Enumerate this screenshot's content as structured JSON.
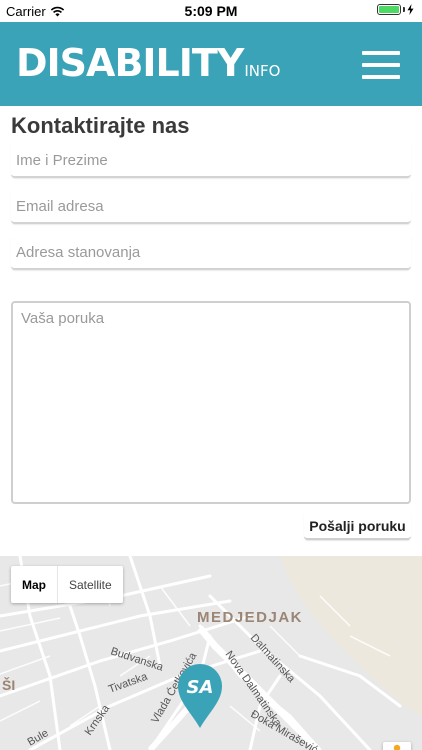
{
  "status_bar": {
    "carrier": "Carrier",
    "time": "5:09 PM"
  },
  "header": {
    "logo_main": "DISABILITY",
    "logo_sub": "INFO",
    "brand_color": "#3aa3b8"
  },
  "form": {
    "title": "Kontaktirajte nas",
    "name_placeholder": "Ime i Prezime",
    "email_placeholder": "Email adresa",
    "address_placeholder": "Adresa stanovanja",
    "message_placeholder": "Vaša poruka",
    "send_label": "Pošalji poruku"
  },
  "map": {
    "type_map": "Map",
    "type_satellite": "Satellite",
    "selected_type": "Map",
    "district_label": "MEDJEDJAK",
    "partial_label": "ŠI",
    "streets": [
      "Budvanska",
      "Tivatska",
      "Vlada Ćetkovića",
      "Nova Dalmatinska",
      "Dalmatinska",
      "Đoka Mirašević",
      "Krnska",
      "Bule"
    ],
    "marker_text": "SA",
    "marker_color": "#3aa3b8"
  }
}
